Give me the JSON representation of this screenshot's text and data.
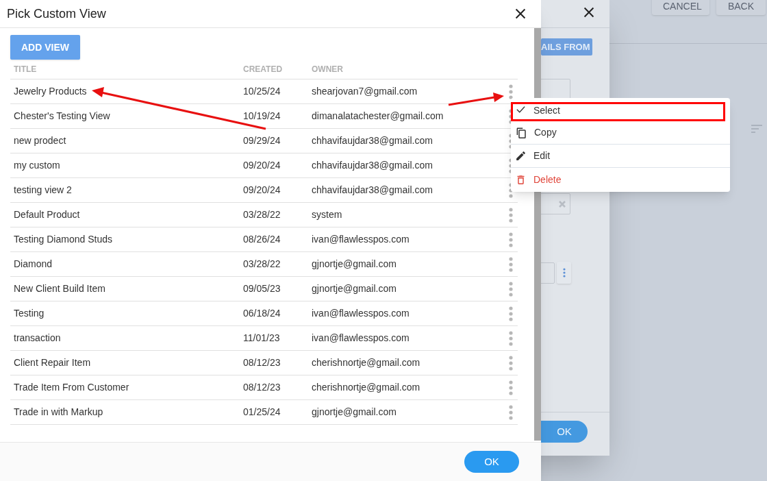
{
  "page": {
    "buttons": [
      "CANCEL",
      "BACK"
    ]
  },
  "back_dialog": {
    "button": "AILS FROM",
    "ok": "OK"
  },
  "dialog": {
    "title": "Pick Custom View",
    "add_button": "ADD VIEW",
    "columns": [
      "TITLE",
      "CREATED",
      "OWNER"
    ],
    "rows": [
      {
        "title": "Jewelry Products",
        "created": "10/25/24",
        "owner": "shearjovan7@gmail.com"
      },
      {
        "title": "Chester's Testing View",
        "created": "10/19/24",
        "owner": "dimanalatachester@gmail.com"
      },
      {
        "title": "new prodect",
        "created": "09/29/24",
        "owner": "chhavifaujdar38@gmail.com"
      },
      {
        "title": "my custom",
        "created": "09/20/24",
        "owner": "chhavifaujdar38@gmail.com"
      },
      {
        "title": "testing view 2",
        "created": "09/20/24",
        "owner": "chhavifaujdar38@gmail.com"
      },
      {
        "title": "Default Product",
        "created": "03/28/22",
        "owner": "system"
      },
      {
        "title": "Testing Diamond Studs",
        "created": "08/26/24",
        "owner": "ivan@flawlesspos.com"
      },
      {
        "title": "Diamond",
        "created": "03/28/22",
        "owner": "gjnortje@gmail.com"
      },
      {
        "title": "New Client Build Item",
        "created": "09/05/23",
        "owner": "gjnortje@gmail.com"
      },
      {
        "title": "Testing",
        "created": "06/18/24",
        "owner": "ivan@flawlesspos.com"
      },
      {
        "title": "transaction",
        "created": "11/01/23",
        "owner": "ivan@flawlesspos.com"
      },
      {
        "title": "Client Repair Item",
        "created": "08/12/23",
        "owner": "cherishnortje@gmail.com"
      },
      {
        "title": "Trade Item From Customer",
        "created": "08/12/23",
        "owner": "cherishnortje@gmail.com"
      },
      {
        "title": "Trade in with Markup",
        "created": "01/25/24",
        "owner": "gjnortje@gmail.com"
      }
    ],
    "ok": "OK"
  },
  "context_menu": {
    "items": [
      {
        "kind": "select",
        "label": "Select",
        "highlighted": true
      },
      {
        "kind": "copy",
        "label": "Copy",
        "highlighted": false
      },
      {
        "kind": "edit",
        "label": "Edit",
        "highlighted": false
      },
      {
        "kind": "delete",
        "label": "Delete",
        "highlighted": false
      }
    ]
  }
}
